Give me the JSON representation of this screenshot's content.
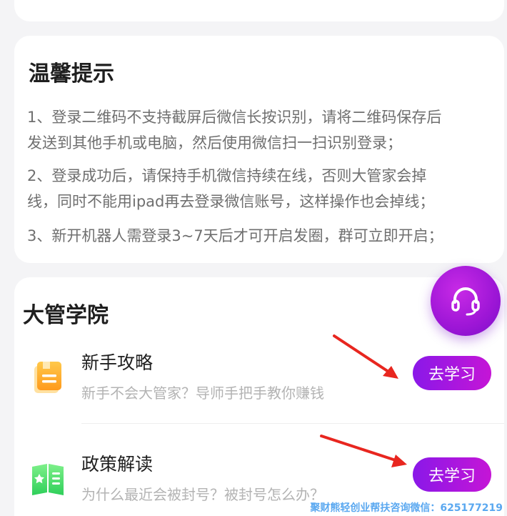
{
  "tips": {
    "title": "温馨提示",
    "items": [
      {
        "line1": "1、登录二维码不支持截屏后微信长按识别，请将二维码保存后",
        "line2": "发送到其他手机或电脑，然后使用微信扫一扫识别登录；"
      },
      {
        "line1": "2、登录成功后，请保持手机微信持续在线，否则大管家会掉",
        "line2": "线，同时不能用ipad再去登录微信账号，这样操作也会掉线；"
      },
      {
        "line1": "3、新开机器人需登录3~7天后才可开启发圈，群可立即开启；",
        "line2": ""
      }
    ]
  },
  "academy": {
    "title": "大管学院",
    "items": [
      {
        "title": "新手攻略",
        "desc": "新手不会大管家？导师手把手教你赚钱",
        "button": "去学习",
        "icon": "book-icon"
      },
      {
        "title": "政策解读",
        "desc": "为什么最近会被封号？被封号怎么办？",
        "button": "去学习",
        "icon": "open-book-icon"
      }
    ]
  },
  "support": {
    "icon": "headset-icon"
  },
  "watermark": "聚财熊轻创业帮扶咨询微信：625177219",
  "colors": {
    "accent": "#9d16d6",
    "arrow": "#e8261f",
    "watermark": "#5aa8f0"
  }
}
